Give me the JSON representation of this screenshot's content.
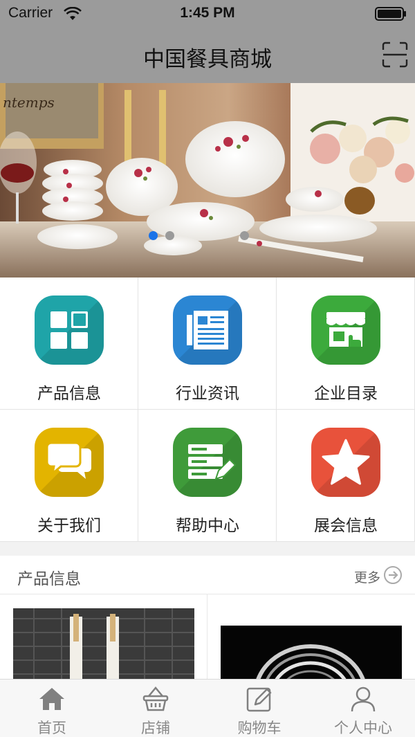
{
  "status_bar": {
    "carrier": "Carrier",
    "time": "1:45 PM"
  },
  "header": {
    "title": "中国餐具商城",
    "scan_icon": "scan-icon"
  },
  "banner": {
    "page_count": 3,
    "active_page": 1
  },
  "grid": [
    {
      "label": "产品信息",
      "icon": "grid-squares-icon",
      "color": "#1fa4a8"
    },
    {
      "label": "行业资讯",
      "icon": "newspaper-icon",
      "color": "#2b86d3"
    },
    {
      "label": "企业目录",
      "icon": "storefront-icon",
      "color": "#3caa3c"
    },
    {
      "label": "关于我们",
      "icon": "chat-bubbles-icon",
      "color": "#e3b400"
    },
    {
      "label": "帮助中心",
      "icon": "server-edit-icon",
      "color": "#3f9b3a"
    },
    {
      "label": "展会信息",
      "icon": "star-icon",
      "color": "#e8523b"
    }
  ],
  "products_section": {
    "title": "产品信息",
    "more": "更多"
  },
  "tabbar": [
    {
      "label": "首页",
      "icon": "home-icon"
    },
    {
      "label": "店铺",
      "icon": "basket-icon"
    },
    {
      "label": "购物车",
      "icon": "edit-icon"
    },
    {
      "label": "个人中心",
      "icon": "user-icon"
    }
  ]
}
